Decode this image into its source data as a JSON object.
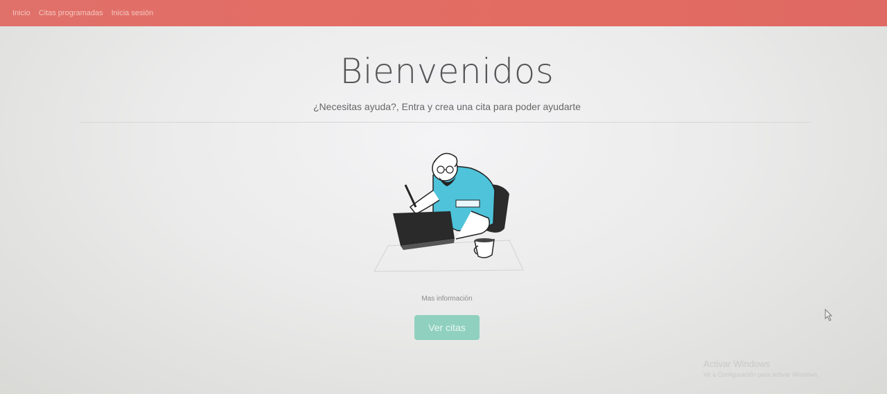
{
  "nav": {
    "items": [
      {
        "label": "Inicio"
      },
      {
        "label": "Citas programadas"
      },
      {
        "label": "Inicia sesión"
      }
    ],
    "bar_color": "#e0706a"
  },
  "hero": {
    "title": "Bienvenidos",
    "subtitle": "¿Necesitas ayuda?, Entra y crea una cita para poder ayudarte"
  },
  "illustration": {
    "icon": "person-at-computer-illustration"
  },
  "more_info": "Mas información",
  "cta": {
    "label": "Ver citas",
    "color": "#8fd0be"
  },
  "watermark": {
    "line1": "Activar Windows",
    "line2": "Ve a Configuración para activar Windows."
  }
}
